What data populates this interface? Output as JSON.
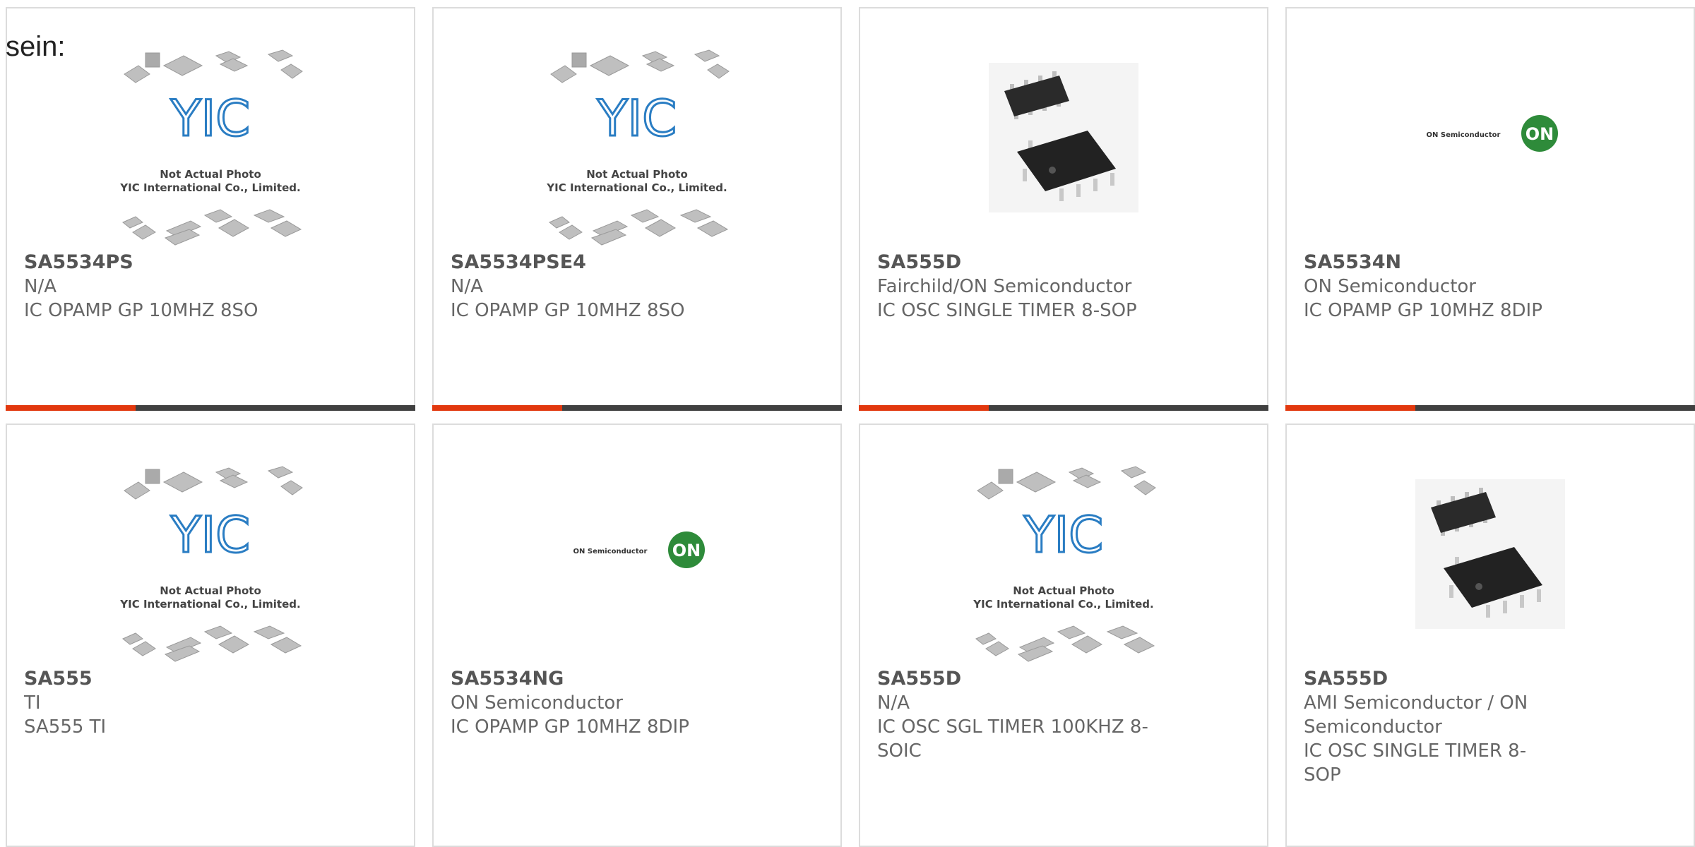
{
  "intro_text": "sein:",
  "placeholder_image": {
    "line1": "Not Actual Photo",
    "line2": "YIC International Co., Limited."
  },
  "brand_logo": {
    "name": "ON Semiconductor",
    "badge": "ON"
  },
  "products": [
    {
      "part": "SA5534PS",
      "maker": "N/A",
      "description": "IC OPAMP GP 10MHZ 8SO",
      "image": "yic-placeholder"
    },
    {
      "part": "SA5534PSE4",
      "maker": "N/A",
      "description": "IC OPAMP GP 10MHZ 8SO",
      "image": "yic-placeholder"
    },
    {
      "part": "SA555D",
      "maker": "Fairchild/ON Semiconductor",
      "description": "IC OSC SINGLE TIMER 8-SOP",
      "image": "chip-photo"
    },
    {
      "part": "SA5534N",
      "maker": "ON Semiconductor",
      "description": "IC OPAMP GP 10MHZ 8DIP",
      "image": "on-logo"
    },
    {
      "part": "SA555",
      "maker": "TI",
      "description": "SA555 TI",
      "image": "yic-placeholder"
    },
    {
      "part": "SA5534NG",
      "maker": "ON Semiconductor",
      "description": "IC OPAMP GP 10MHZ 8DIP",
      "image": "on-logo"
    },
    {
      "part": "SA555D",
      "maker": "N/A",
      "description": "IC OSC SGL TIMER 100KHZ 8-SOIC",
      "image": "yic-placeholder"
    },
    {
      "part": "SA555D",
      "maker": "AMI Semiconductor / ON Semiconductor",
      "description": "IC OSC SINGLE TIMER 8-SOP",
      "image": "chip-photo"
    }
  ],
  "colors": {
    "accent": "#e2380e",
    "bar": "#404040",
    "border": "#dcdcdc",
    "text": "#666666",
    "yic_blue": "#2a7dc3",
    "on_green": "#2e8b3a"
  }
}
